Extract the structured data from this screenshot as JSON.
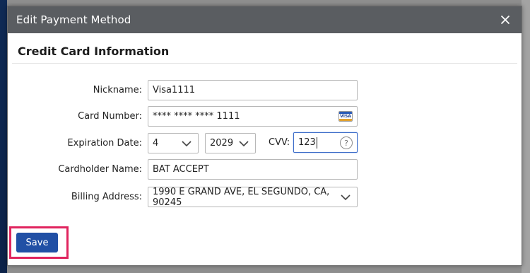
{
  "dialog": {
    "title": "Edit Payment Method",
    "close_icon": "close-icon",
    "section_title": "Credit Card Information"
  },
  "form": {
    "nickname": {
      "label": "Nickname:",
      "value": "Visa1111"
    },
    "card_number": {
      "label": "Card Number:",
      "value": "**** **** **** 1111",
      "card_icon": "visa-card-icon",
      "card_brand": "VISA"
    },
    "expiration": {
      "label": "Expiration Date:",
      "month": "4",
      "year": "2029"
    },
    "cvv": {
      "label": "CVV:",
      "value": "123",
      "help_glyph": "?"
    },
    "cardholder": {
      "label": "Cardholder Name:",
      "value": "BAT ACCEPT"
    },
    "billing_address": {
      "label": "Billing Address:",
      "value": "1990 E GRAND AVE, EL SEGUNDO, CA, 90245"
    }
  },
  "actions": {
    "save_label": "Save"
  },
  "colors": {
    "header_bg": "#5a5d61",
    "primary_button": "#2150a5",
    "highlight_border": "#e0245e",
    "focus_border": "#3f6ec9"
  }
}
